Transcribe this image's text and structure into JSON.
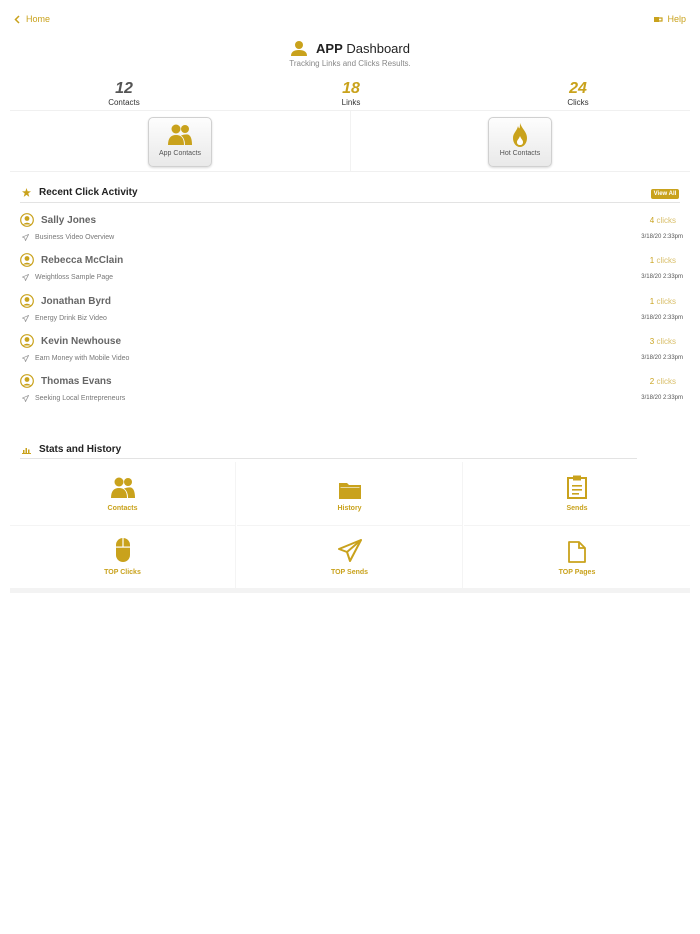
{
  "nav": {
    "home_label": "Home",
    "help_label": "Help"
  },
  "header": {
    "title_bold": "APP",
    "title_rest": " Dashboard",
    "subtitle": "Tracking Links and Clicks Results."
  },
  "stats": [
    {
      "value": "12",
      "label": "Contacts",
      "color": "#555555"
    },
    {
      "value": "18",
      "label": "Links",
      "color": "#c9a21c"
    },
    {
      "value": "24",
      "label": "Clicks",
      "color": "#c9a21c"
    }
  ],
  "tiles": [
    {
      "label": "App Contacts",
      "icon": "users-icon"
    },
    {
      "label": "Hot Contacts",
      "icon": "flame-icon"
    }
  ],
  "recent": {
    "title": "Recent Click Activity",
    "view_all": "View All",
    "items": [
      {
        "name": "Sally Jones",
        "count": "4",
        "unit": "clicks",
        "page": "Business Video Overview",
        "date": "3/18/20 2:33pm"
      },
      {
        "name": "Rebecca McClain",
        "count": "1",
        "unit": "clicks",
        "page": "Weightloss Sample Page",
        "date": "3/18/20 2:33pm"
      },
      {
        "name": "Jonathan Byrd",
        "count": "1",
        "unit": "clicks",
        "page": "Energy Drink Biz Video",
        "date": "3/18/20 2:33pm"
      },
      {
        "name": "Kevin Newhouse",
        "count": "3",
        "unit": "clicks",
        "page": "Earn Money with Mobile Video",
        "date": "3/18/20 2:33pm"
      },
      {
        "name": "Thomas Evans",
        "count": "2",
        "unit": "clicks",
        "page": "Seeking Local Entrepreneurs",
        "date": "3/18/20 2:33pm"
      }
    ]
  },
  "history": {
    "title": "Stats and History",
    "cells": [
      {
        "label": "Contacts",
        "icon": "users-icon"
      },
      {
        "label": "History",
        "icon": "folder-icon"
      },
      {
        "label": "Sends",
        "icon": "clipboard-icon"
      },
      {
        "label": "TOP Clicks",
        "icon": "mouse-icon"
      },
      {
        "label": "TOP Sends",
        "icon": "paper-plane-icon"
      },
      {
        "label": "TOP Pages",
        "icon": "document-icon"
      }
    ]
  },
  "colors": {
    "accent": "#c9a21c",
    "text": "#333333"
  }
}
